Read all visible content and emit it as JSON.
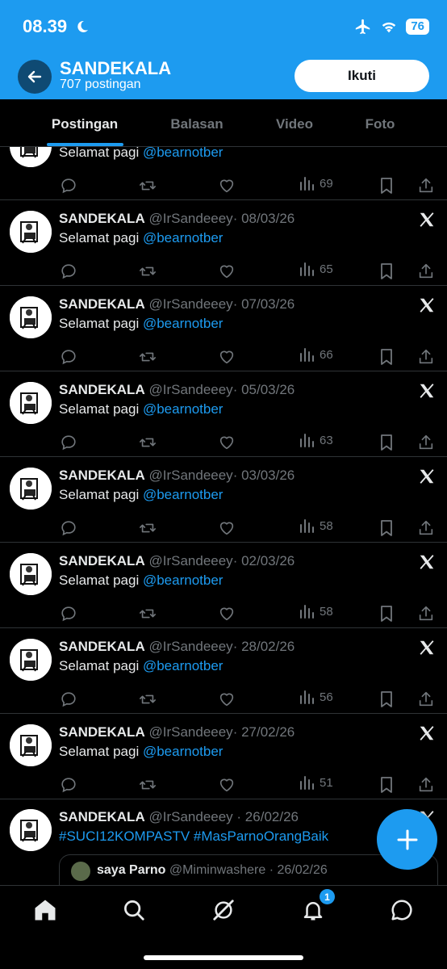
{
  "status_bar": {
    "time": "08.39",
    "battery": "76"
  },
  "header": {
    "title": "SANDEKALA",
    "subtitle": "707 postingan",
    "follow_label": "Ikuti"
  },
  "tabs": [
    {
      "label": "Postingan",
      "active": true
    },
    {
      "label": "Balasan",
      "active": false
    },
    {
      "label": "Video",
      "active": false
    },
    {
      "label": "Foto",
      "active": false
    }
  ],
  "tweets": [
    {
      "name": "",
      "handle": "",
      "date": "",
      "text": "Selamat pagi ",
      "mention": "@bearnotber",
      "views": "69"
    },
    {
      "name": "SANDEKALA",
      "handle": "@IrSandeeey",
      "date": "· 08/03/26",
      "text": "Selamat pagi ",
      "mention": "@bearnotber",
      "views": "65"
    },
    {
      "name": "SANDEKALA",
      "handle": "@IrSandeeey",
      "date": "· 07/03/26",
      "text": "Selamat pagi ",
      "mention": "@bearnotber",
      "views": "66"
    },
    {
      "name": "SANDEKALA",
      "handle": "@IrSandeeey",
      "date": "· 05/03/26",
      "text": "Selamat pagi ",
      "mention": "@bearnotber",
      "views": "63"
    },
    {
      "name": "SANDEKALA",
      "handle": "@IrSandeeey",
      "date": "· 03/03/26",
      "text": "Selamat pagi ",
      "mention": "@bearnotber",
      "views": "58"
    },
    {
      "name": "SANDEKALA",
      "handle": "@IrSandeeey",
      "date": "· 02/03/26",
      "text": "Selamat pagi ",
      "mention": "@bearnotber",
      "views": "58"
    },
    {
      "name": "SANDEKALA",
      "handle": "@IrSandeeey",
      "date": "· 28/02/26",
      "text": "Selamat pagi ",
      "mention": "@bearnotber",
      "views": "56"
    },
    {
      "name": "SANDEKALA",
      "handle": "@IrSandeeey",
      "date": "· 27/02/26",
      "text": "Selamat pagi ",
      "mention": "@bearnotber",
      "views": "51"
    }
  ],
  "last_tweet": {
    "name": "SANDEKALA",
    "handle": "@IrSandeeey",
    "date": "· 26/02/26",
    "hashtags": "#SUCI12KOMPASTV #MasParnoOrangBaik",
    "quote": {
      "name": "saya Parno",
      "handle": "@Miminwashere",
      "date": "· 26/02/26"
    }
  },
  "bottom_nav": {
    "notification_count": "1"
  },
  "icons": [
    "back-arrow-icon",
    "moon-icon",
    "airplane-icon",
    "wifi-icon",
    "x-logo-icon",
    "reply-icon",
    "retweet-icon",
    "like-icon",
    "views-icon",
    "bookmark-icon",
    "share-icon",
    "plus-icon",
    "home-icon",
    "search-icon",
    "grok-icon",
    "bell-icon",
    "messages-icon"
  ],
  "colors": {
    "accent": "#1d9bf0",
    "background": "#000000",
    "muted": "#71767b"
  }
}
